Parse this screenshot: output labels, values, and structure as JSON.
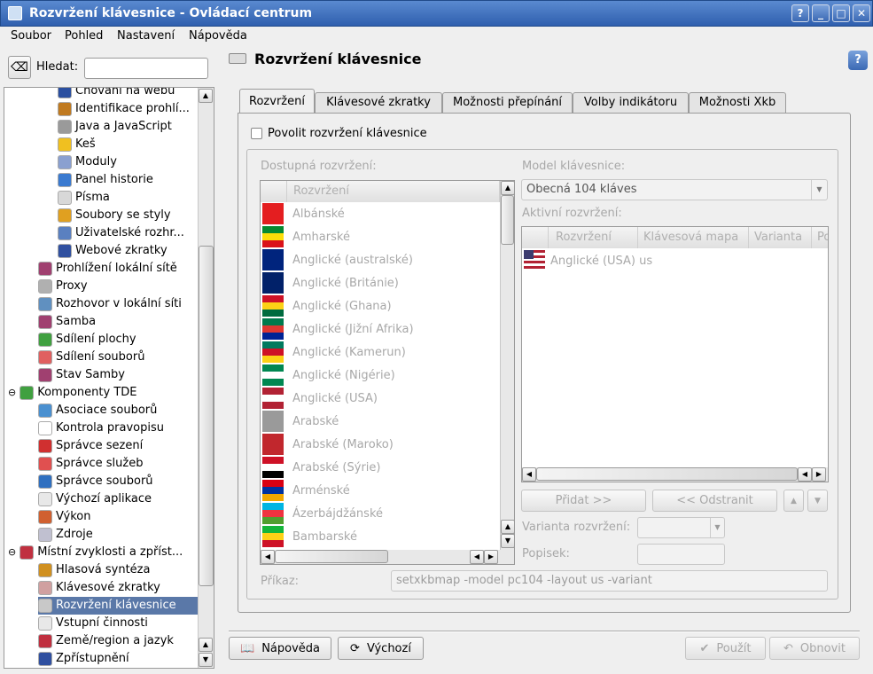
{
  "window": {
    "title": "Rozvržení klávesnice - Ovládací centrum",
    "buttons": [
      "?",
      "_",
      "□",
      "✕"
    ]
  },
  "menu": [
    "Soubor",
    "Pohled",
    "Nastavení",
    "Nápověda"
  ],
  "search": {
    "label": "Hledat:",
    "value": ""
  },
  "tree": [
    {
      "label": "Chování na webu",
      "level": 2,
      "color": "#2a4fa0"
    },
    {
      "label": "Identifikace prohlí...",
      "level": 2,
      "color": "#c07a20"
    },
    {
      "label": "Java a JavaScript",
      "level": 2,
      "color": "#9a9a9a"
    },
    {
      "label": "Keš",
      "level": 2,
      "color": "#f0c020"
    },
    {
      "label": "Moduly",
      "level": 2,
      "color": "#8aa0d0"
    },
    {
      "label": "Panel historie",
      "level": 2,
      "color": "#3a7ad0"
    },
    {
      "label": "Písma",
      "level": 2,
      "color": "#d8d8d8"
    },
    {
      "label": "Soubory se styly",
      "level": 2,
      "color": "#e0a020"
    },
    {
      "label": "Uživatelské rozhr...",
      "level": 2,
      "color": "#5a80c0"
    },
    {
      "label": "Webové zkratky",
      "level": 2,
      "color": "#3050a0"
    },
    {
      "label": "Prohlížení lokální sítě",
      "level": 1,
      "color": "#a04070"
    },
    {
      "label": "Proxy",
      "level": 1,
      "color": "#b0b0b0"
    },
    {
      "label": "Rozhovor v lokální síti",
      "level": 1,
      "color": "#6090c0"
    },
    {
      "label": "Samba",
      "level": 1,
      "color": "#a04070"
    },
    {
      "label": "Sdílení plochy",
      "level": 1,
      "color": "#40a040"
    },
    {
      "label": "Sdílení souborů",
      "level": 1,
      "color": "#e06060"
    },
    {
      "label": "Stav Samby",
      "level": 1,
      "color": "#a04070"
    },
    {
      "label": "Komponenty TDE",
      "level": 0,
      "color": "#40a040",
      "expander": "⊖"
    },
    {
      "label": "Asociace souborů",
      "level": 1,
      "color": "#4a90d0"
    },
    {
      "label": "Kontrola pravopisu",
      "level": 1,
      "color": "#ffffff"
    },
    {
      "label": "Správce sezení",
      "level": 1,
      "color": "#d03030"
    },
    {
      "label": "Správce služeb",
      "level": 1,
      "color": "#e05050"
    },
    {
      "label": "Správce souborů",
      "level": 1,
      "color": "#3070c0"
    },
    {
      "label": "Výchozí aplikace",
      "level": 1,
      "color": "#e8e8e8"
    },
    {
      "label": "Výkon",
      "level": 1,
      "color": "#d06030"
    },
    {
      "label": "Zdroje",
      "level": 1,
      "color": "#c0c0d0"
    },
    {
      "label": "Místní zvyklosti a zpříst...",
      "level": 0,
      "color": "#c03040",
      "expander": "⊖"
    },
    {
      "label": "Hlasová syntéza",
      "level": 1,
      "color": "#d09020"
    },
    {
      "label": "Klávesové zkratky",
      "level": 1,
      "color": "#d0a0a0"
    },
    {
      "label": "Rozvržení klávesnice",
      "level": 1,
      "color": "#c8c8c8",
      "selected": true
    },
    {
      "label": "Vstupní činnosti",
      "level": 1,
      "color": "#e8e8e8"
    },
    {
      "label": "Země/region a jazyk",
      "level": 1,
      "color": "#c03040"
    },
    {
      "label": "Zpřístupnění",
      "level": 1,
      "color": "#3050a0"
    }
  ],
  "page": {
    "title": "Rozvržení klávesnice"
  },
  "tabs": [
    "Rozvržení",
    "Klávesové zkratky",
    "Možnosti přepínání",
    "Volby indikátoru",
    "Možnosti Xkb"
  ],
  "enable_checkbox": {
    "label": "Povolit rozvržení klávesnice",
    "checked": false
  },
  "available": {
    "label": "Dostupná rozvržení:",
    "header": "Rozvržení",
    "items": [
      {
        "name": "Albánské",
        "flag": [
          "#e41e20",
          "#e41e20"
        ]
      },
      {
        "name": "Amharské",
        "flag": [
          "#078930",
          "#fcdd09",
          "#da121a"
        ]
      },
      {
        "name": "Anglické (australské)",
        "flag": [
          "#00247d",
          "#00247d"
        ]
      },
      {
        "name": "Anglické (Británie)",
        "flag": [
          "#012169",
          "#c8102e"
        ]
      },
      {
        "name": "Anglické (Ghana)",
        "flag": [
          "#ce1126",
          "#fcd116",
          "#006b3f"
        ]
      },
      {
        "name": "Anglické (Jižní Afrika)",
        "flag": [
          "#007a4d",
          "#de3831",
          "#002395"
        ]
      },
      {
        "name": "Anglické (Kamerun)",
        "flag": [
          "#007a5e",
          "#ce1126",
          "#fcd116"
        ]
      },
      {
        "name": "Anglické (Nigérie)",
        "flag": [
          "#008751",
          "#ffffff",
          "#008751"
        ]
      },
      {
        "name": "Anglické (USA)",
        "flag": [
          "#b22234",
          "#ffffff",
          "#b22234"
        ]
      },
      {
        "name": "Arabské",
        "flag": [
          "#9a9a9a",
          "#9a9a9a"
        ]
      },
      {
        "name": "Arabské (Maroko)",
        "flag": [
          "#c1272d",
          "#c1272d"
        ]
      },
      {
        "name": "Arabské (Sýrie)",
        "flag": [
          "#ce1126",
          "#ffffff",
          "#000000"
        ]
      },
      {
        "name": "Arménské",
        "flag": [
          "#d90012",
          "#0033a0",
          "#f2a800"
        ]
      },
      {
        "name": "Ázerbájdžánské",
        "flag": [
          "#00b5e2",
          "#ef3340",
          "#509e2f"
        ]
      },
      {
        "name": "Bambarské",
        "flag": [
          "#14b53a",
          "#fcd116",
          "#ce1126"
        ]
      }
    ]
  },
  "model": {
    "label": "Model klávesnice:",
    "value": "Obecná 104 kláves"
  },
  "active": {
    "label": "Aktivní rozvržení:",
    "headers": [
      "Rozvržení",
      "Klávesová mapa",
      "Varianta",
      "Po"
    ],
    "rows": [
      {
        "text": "Anglické (USA) us"
      }
    ]
  },
  "buttons": {
    "add": "Přidat >>",
    "remove": "<< Odstranit",
    "variant_label": "Varianta rozvržení:",
    "label_label": "Popisek:",
    "command_label": "Příkaz:",
    "command_value": "setxkbmap -model pc104 -layout us -variant"
  },
  "footer": {
    "help": "Nápověda",
    "defaults": "Výchozí",
    "apply": "Použít",
    "reset": "Obnovit"
  }
}
